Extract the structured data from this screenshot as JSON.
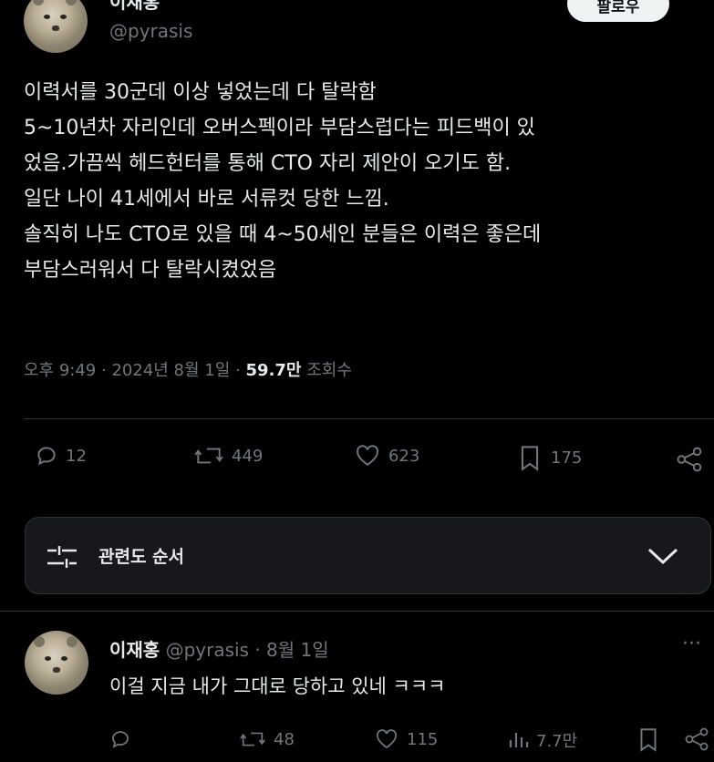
{
  "author": {
    "name": "이재홍",
    "handle": "@pyrasis",
    "follow_label": "팔로우"
  },
  "tweet": {
    "lines": [
      "이력서를 30군데 이상 넣었는데 다 탈락함",
      "5~10년차 자리인데 오버스펙이라 부담스럽다는 피드백이 있",
      "었음.가끔씩 헤드헌터를 통해 CTO 자리 제안이 오기도 함.",
      "일단 나이 41세에서 바로 서류컷 당한 느낌.",
      "솔직히 나도 CTO로 있을 때 4~50세인 분들은 이력은 좋은데",
      "부담스러워서 다 탈락시켰었음"
    ],
    "time": "오후 9:49",
    "separator": "·",
    "date": "2024년 8월 1일",
    "views_value": "59.7만",
    "views_label": "조회수"
  },
  "actions": {
    "replies": "12",
    "reposts": "449",
    "likes": "623",
    "bookmarks": "175"
  },
  "sort": {
    "label": "관련도 순서"
  },
  "reply": {
    "name": "이재홍",
    "handle": "@pyrasis",
    "separator": "·",
    "date": "8월 1일",
    "text": "이걸 지금 내가 그대로 당하고 있네 ㅋㅋㅋ",
    "more": "···",
    "actions": {
      "reposts": "48",
      "likes": "115",
      "views": "7.7만"
    }
  }
}
